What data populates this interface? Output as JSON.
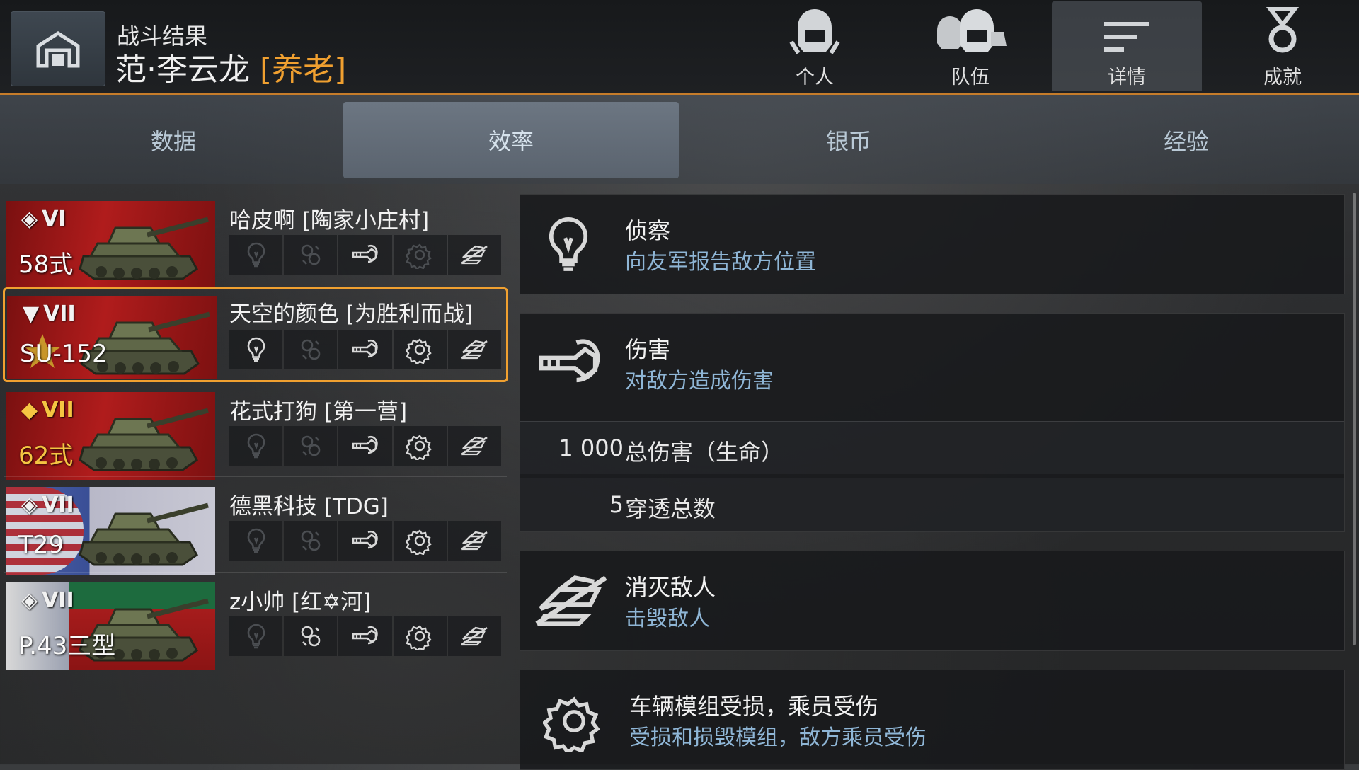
{
  "header": {
    "title_small": "战斗结果",
    "player_name": "范·李云龙",
    "player_clan": "[养老]",
    "tabs": [
      {
        "label": "个人",
        "icon": "single-helmet-icon"
      },
      {
        "label": "队伍",
        "icon": "team-helmets-icon"
      },
      {
        "label": "详情",
        "icon": "details-list-icon",
        "active": true
      },
      {
        "label": "成就",
        "icon": "medal-icon"
      }
    ]
  },
  "subtabs": [
    {
      "label": "数据"
    },
    {
      "label": "效率",
      "active": true
    },
    {
      "label": "银币"
    },
    {
      "label": "经验"
    }
  ],
  "players": [
    {
      "tier": "VI",
      "tank": "58式",
      "name": "哈皮啊 [陶家小庄村]",
      "nation": "china",
      "icons_active": [
        false,
        false,
        true,
        false,
        true
      ]
    },
    {
      "tier": "VII",
      "tank": "SU-152",
      "name": "天空的颜色 [为胜利而战]",
      "nation": "ussr",
      "selected": true,
      "icons_active": [
        true,
        false,
        true,
        true,
        true
      ]
    },
    {
      "tier": "VII",
      "tank": "62式",
      "name": "花式打狗 [第一营]",
      "nation": "china",
      "premium": true,
      "icons_active": [
        false,
        false,
        true,
        true,
        true
      ]
    },
    {
      "tier": "VII",
      "tank": "T29",
      "name": "德黑科技 [TDG]",
      "nation": "usa",
      "icons_active": [
        false,
        false,
        true,
        true,
        true
      ]
    },
    {
      "tier": "VII",
      "tank": "P.43三型",
      "name": "z小帅 [红✡河]",
      "nation": "italy",
      "icons_active": [
        false,
        true,
        true,
        true,
        true
      ]
    }
  ],
  "details": {
    "spotting": {
      "title": "侦察",
      "subtitle": "向友军报告敌方位置",
      "icon": "lightbulb-icon"
    },
    "damage": {
      "title": "伤害",
      "subtitle": "对敌方造成伤害",
      "icon": "shell-hit-icon",
      "stats": [
        {
          "value": "1 000",
          "label": "总伤害（生命）"
        },
        {
          "value": "5",
          "label": "穿透总数"
        }
      ]
    },
    "destroyed": {
      "title": "消灭敌人",
      "subtitle": "击毁敌人",
      "icon": "destroyed-tank-icon"
    },
    "modules": {
      "title": "车辆模组受损，乘员受伤",
      "subtitle": "受损和损毁模组，敌方乘员受伤",
      "icon": "gear-damage-icon"
    }
  },
  "colors": {
    "accent": "#f0a030",
    "subtitle": "#8fb6d6"
  }
}
